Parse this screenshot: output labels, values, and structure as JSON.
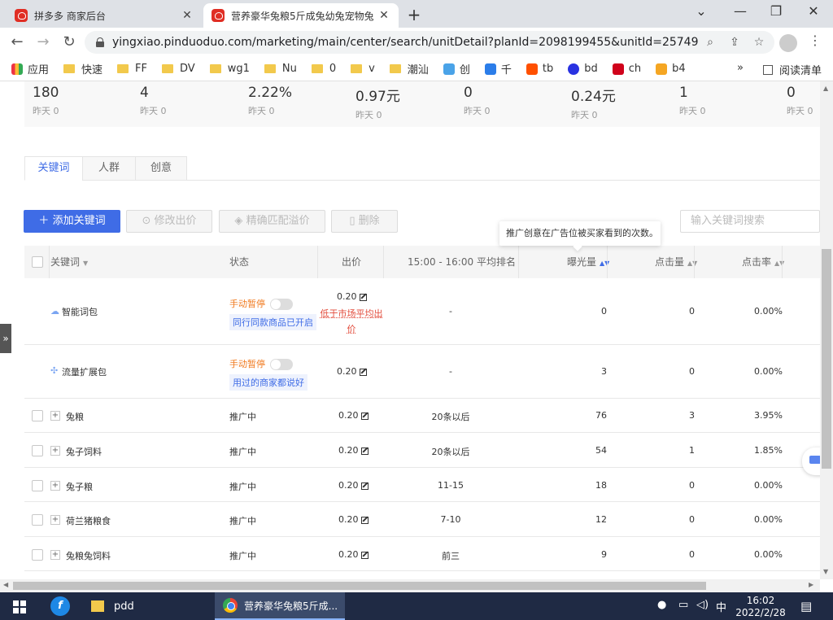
{
  "browser": {
    "tabs": [
      {
        "title": "拼多多 商家后台",
        "close": "✕"
      },
      {
        "title": "营养豪华兔粮5斤成兔幼兔宠物兔",
        "close": "✕"
      }
    ],
    "new_tab": "+",
    "url": "yingxiao.pinduoduo.com/marketing/main/center/search/unitDetail?planId=2098199455&unitId=25749...",
    "window_controls": {
      "collapse": "⌄",
      "minimize": "—",
      "restore": "❐",
      "close": "✕"
    }
  },
  "bookmarks": [
    {
      "label": "应用",
      "icon": "apps-grid-icon"
    },
    {
      "label": "快速",
      "icon": "folder-icon"
    },
    {
      "label": "FF",
      "icon": "folder-icon"
    },
    {
      "label": "DV",
      "icon": "folder-icon"
    },
    {
      "label": "wg1",
      "icon": "folder-icon"
    },
    {
      "label": "Nu",
      "icon": "folder-icon"
    },
    {
      "label": "0",
      "icon": "folder-icon"
    },
    {
      "label": "v",
      "icon": "folder-icon"
    },
    {
      "label": "潮汕",
      "icon": "folder-icon"
    },
    {
      "label": "创",
      "icon": "tv-icon"
    },
    {
      "label": "千",
      "icon": "qianniu-icon"
    },
    {
      "label": "tb",
      "icon": "taobao-icon"
    },
    {
      "label": "bd",
      "icon": "baidu-paw-icon"
    },
    {
      "label": "ch",
      "icon": "zhong-icon"
    },
    {
      "label": "b4",
      "icon": "bag-icon"
    }
  ],
  "bookmarks_more": "»",
  "reading_list": "阅读清单",
  "stats": [
    {
      "value": "180",
      "sub": "昨天 0"
    },
    {
      "value": "4",
      "sub": "昨天 0"
    },
    {
      "value": "2.22%",
      "sub": "昨天 0"
    },
    {
      "value": "0.97元",
      "sub": "昨天 0"
    },
    {
      "value": "0",
      "sub": "昨天 0"
    },
    {
      "value": "0.24元",
      "sub": "昨天 0"
    },
    {
      "value": "1",
      "sub": "昨天 0"
    },
    {
      "value": "0",
      "sub": "昨天 0"
    }
  ],
  "page_tabs": [
    "关键词",
    "人群",
    "创意"
  ],
  "toolbar": {
    "add": "添加关键词",
    "edit_bid": "修改出价",
    "exact_premium": "精确匹配溢价",
    "delete": "删除",
    "search_placeholder": "输入关键词搜索"
  },
  "tooltip": "推广创意在广告位被买家看到的次数。",
  "table": {
    "headers": {
      "keyword": "关键词",
      "status": "状态",
      "bid": "出价",
      "rank": "15:00 - 16:00 平均排名",
      "impressions": "曝光量",
      "clicks": "点击量",
      "ctr": "点击率"
    },
    "pack_rows": [
      {
        "name": "智能词包",
        "status": "手动暂停",
        "note": "同行同款商品已开启",
        "bid": "0.20",
        "warn": "低于市场平均出价",
        "rank": "-",
        "impressions": "0",
        "clicks": "0",
        "ctr": "0.00%"
      },
      {
        "name": "流量扩展包",
        "status": "手动暂停",
        "note": "用过的商家都说好",
        "bid": "0.20",
        "rank": "-",
        "impressions": "3",
        "clicks": "0",
        "ctr": "0.00%"
      }
    ],
    "rows": [
      {
        "keyword": "兔粮",
        "status": "推广中",
        "bid": "0.20",
        "rank": "20条以后",
        "impressions": "76",
        "clicks": "3",
        "ctr": "3.95%"
      },
      {
        "keyword": "兔子饲料",
        "status": "推广中",
        "bid": "0.20",
        "rank": "20条以后",
        "impressions": "54",
        "clicks": "1",
        "ctr": "1.85%"
      },
      {
        "keyword": "兔子粮",
        "status": "推广中",
        "bid": "0.20",
        "rank": "11-15",
        "impressions": "18",
        "clicks": "0",
        "ctr": "0.00%"
      },
      {
        "keyword": "荷兰猪粮食",
        "status": "推广中",
        "bid": "0.20",
        "rank": "7-10",
        "impressions": "12",
        "clicks": "0",
        "ctr": "0.00%"
      },
      {
        "keyword": "兔粮兔饲料",
        "status": "推广中",
        "bid": "0.20",
        "rank": "前三",
        "impressions": "9",
        "clicks": "0",
        "ctr": "0.00%"
      }
    ]
  },
  "side_handle": "»",
  "taskbar": {
    "folder_label": "pdd",
    "chrome_label": "营养豪华兔粮5斤成...",
    "ime": "中",
    "time": "16:02",
    "date": "2022/2/28"
  }
}
